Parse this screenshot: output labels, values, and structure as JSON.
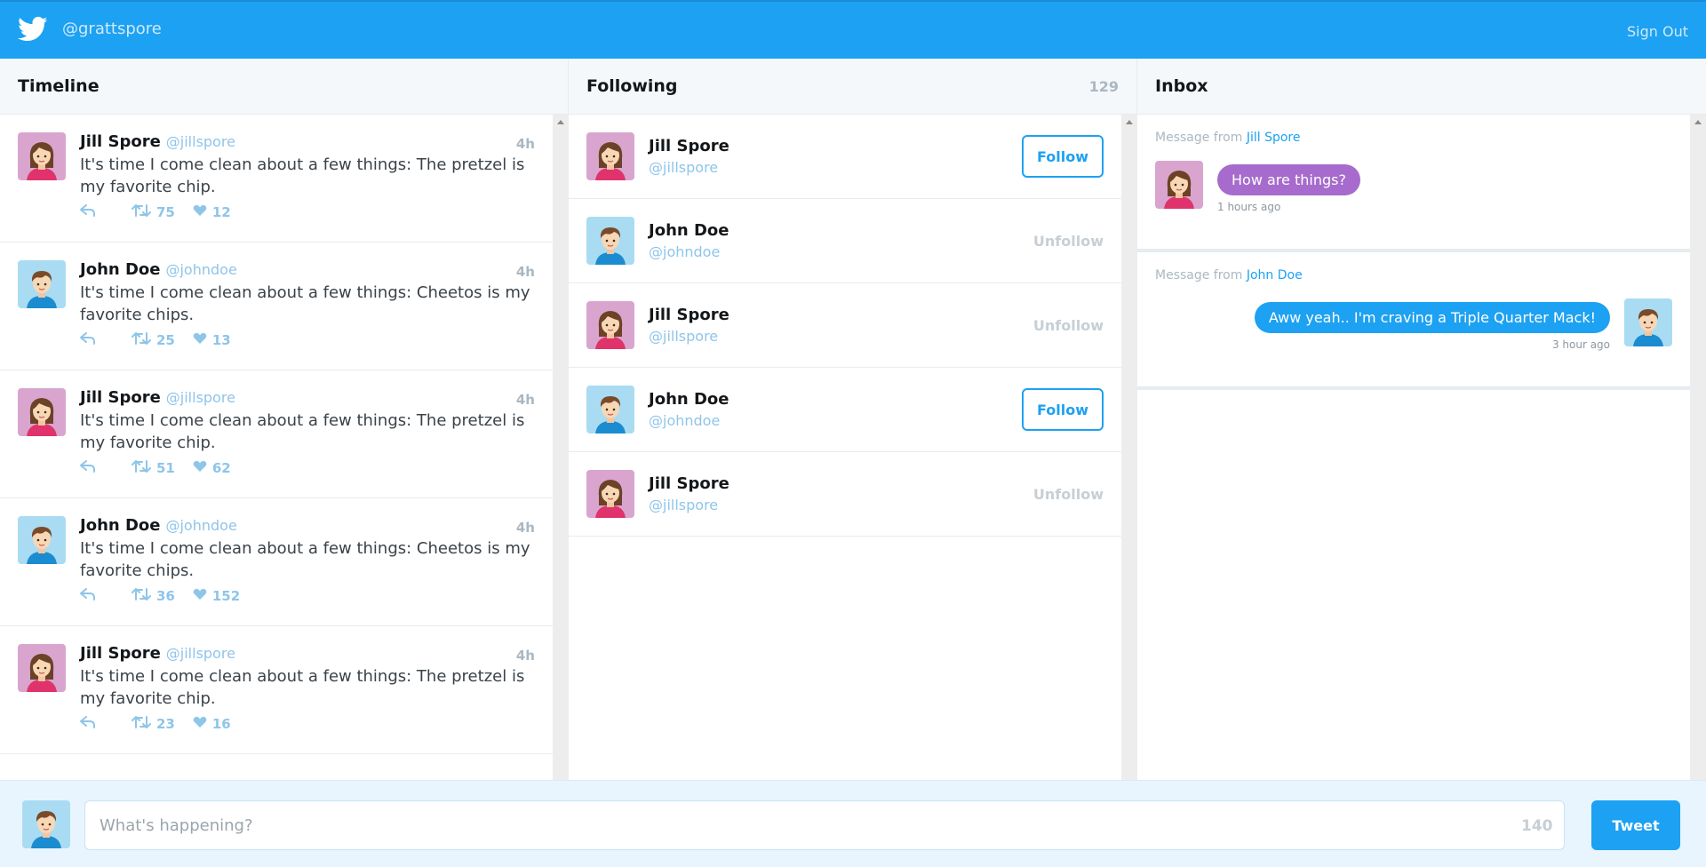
{
  "header": {
    "handle": "@grattspore",
    "signout_label": "Sign Out"
  },
  "colors": {
    "brand": "#1da1f2",
    "link_muted": "#8ec5ea",
    "bubble_purple": "#a66bcc"
  },
  "timeline": {
    "title": "Timeline",
    "tweets": [
      {
        "avatar": "jill",
        "name": "Jill Spore",
        "username": "@jillspore",
        "time": "4h",
        "text": "It's time I come clean about a few things: The pretzel is my favorite chip.",
        "retweets": "75",
        "likes": "12"
      },
      {
        "avatar": "john",
        "name": "John Doe",
        "username": "@johndoe",
        "time": "4h",
        "text": "It's time I come clean about a few things: Cheetos is my favorite chips.",
        "retweets": "25",
        "likes": "13"
      },
      {
        "avatar": "jill",
        "name": "Jill Spore",
        "username": "@jillspore",
        "time": "4h",
        "text": "It's time I come clean about a few things: The pretzel is my favorite chip.",
        "retweets": "51",
        "likes": "62"
      },
      {
        "avatar": "john",
        "name": "John Doe",
        "username": "@johndoe",
        "time": "4h",
        "text": "It's time I come clean about a few things: Cheetos is my favorite chips.",
        "retweets": "36",
        "likes": "152"
      },
      {
        "avatar": "jill",
        "name": "Jill Spore",
        "username": "@jillspore",
        "time": "4h",
        "text": "It's time I come clean about a few things: The pretzel is my favorite chip.",
        "retweets": "23",
        "likes": "16"
      }
    ]
  },
  "following": {
    "title": "Following",
    "count": "129",
    "users": [
      {
        "avatar": "jill",
        "name": "Jill Spore",
        "username": "@jillspore",
        "action": "Follow"
      },
      {
        "avatar": "john",
        "name": "John Doe",
        "username": "@johndoe",
        "action": "Unfollow"
      },
      {
        "avatar": "jill",
        "name": "Jill Spore",
        "username": "@jillspore",
        "action": "Unfollow"
      },
      {
        "avatar": "john",
        "name": "John Doe",
        "username": "@johndoe",
        "action": "Follow"
      },
      {
        "avatar": "jill",
        "name": "Jill Spore",
        "username": "@jillspore",
        "action": "Unfollow"
      }
    ]
  },
  "inbox": {
    "title": "Inbox",
    "from_prefix": "Message from",
    "messages": [
      {
        "from": "Jill Spore",
        "avatar": "jill",
        "text": "How are things?",
        "ago": "1 hours ago",
        "side": "left"
      },
      {
        "from": "John Doe",
        "avatar": "john",
        "text": "Aww yeah.. I'm craving a Triple Quarter Mack!",
        "ago": "3 hour ago",
        "side": "right"
      }
    ]
  },
  "composer": {
    "placeholder": "What's happening?",
    "char_count": "140",
    "tweet_label": "Tweet"
  }
}
